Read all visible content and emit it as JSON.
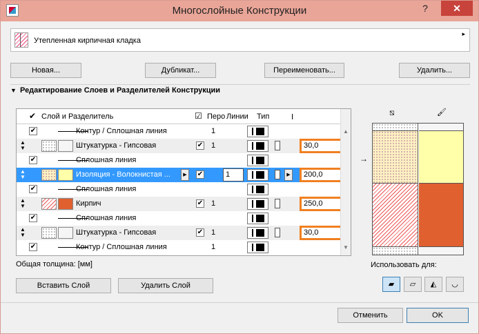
{
  "window": {
    "title": "Многослойные Конструкции",
    "help": "?",
    "close": "✕"
  },
  "combo": {
    "value": "Утепленная кирпичная кладка",
    "arrow": "▸"
  },
  "buttons": {
    "new": "Новая...",
    "duplicate": "Дубликат...",
    "rename": "Переименовать...",
    "delete": "Удалить..."
  },
  "section": {
    "arrow": "▼",
    "title": "Редактирование Слоев и Разделителей Конструкции"
  },
  "table": {
    "header": {
      "check": "✔",
      "layer": "Слой и Разделитель",
      "check2": "☑",
      "pen": "Перо",
      "lines": "Линии",
      "type": "Тип",
      "thickness_icon": "Ⅰ"
    },
    "rows": [
      {
        "kind": "sep",
        "checked": true,
        "label": "Контур / Сплошная линия",
        "pen": "1"
      },
      {
        "kind": "layer",
        "label": "Штукатурка - Гипсовая",
        "fill": "dots",
        "color": "plain",
        "pen": "1",
        "thickness": "30,0"
      },
      {
        "kind": "sep",
        "checked": true,
        "label": "Сплошная линия",
        "pen": ""
      },
      {
        "kind": "layer-sel",
        "label": "Изоляция - Волокнистая ...",
        "fill": "yellowdots",
        "color": "yellow",
        "pen": "1",
        "thickness": "200,0"
      },
      {
        "kind": "sep",
        "checked": true,
        "label": "Сплошная линия",
        "pen": ""
      },
      {
        "kind": "layer",
        "label": "Кирпич",
        "fill": "hatch",
        "color": "orange",
        "pen": "1",
        "thickness": "250,0"
      },
      {
        "kind": "sep",
        "checked": true,
        "label": "Сплошная линия",
        "pen": ""
      },
      {
        "kind": "layer",
        "label": "Штукатурка - Гипсовая",
        "fill": "dots",
        "color": "plain",
        "pen": "1",
        "thickness": "30,0"
      },
      {
        "kind": "sep",
        "checked": true,
        "label": "Контур / Сплошная линия",
        "pen": "1"
      }
    ]
  },
  "total_label": "Общая толщина: [мм]",
  "layer_buttons": {
    "insert": "Вставить Слой",
    "delete": "Удалить Слой"
  },
  "preview": {
    "fill_icon": "⧅",
    "pen_icon": "🖌",
    "arrow": "→"
  },
  "use_for": {
    "label": "Использовать для:",
    "icons": [
      "wall-icon",
      "slab-icon",
      "roof-icon",
      "shell-icon"
    ]
  },
  "dialog": {
    "cancel": "Отменить",
    "ok": "OK"
  },
  "colors": {
    "titlebar": "#e9a598",
    "selection": "#3399ff",
    "highlight": "#f08020",
    "insulation": "#ffffaa",
    "brick": "#e06030"
  }
}
